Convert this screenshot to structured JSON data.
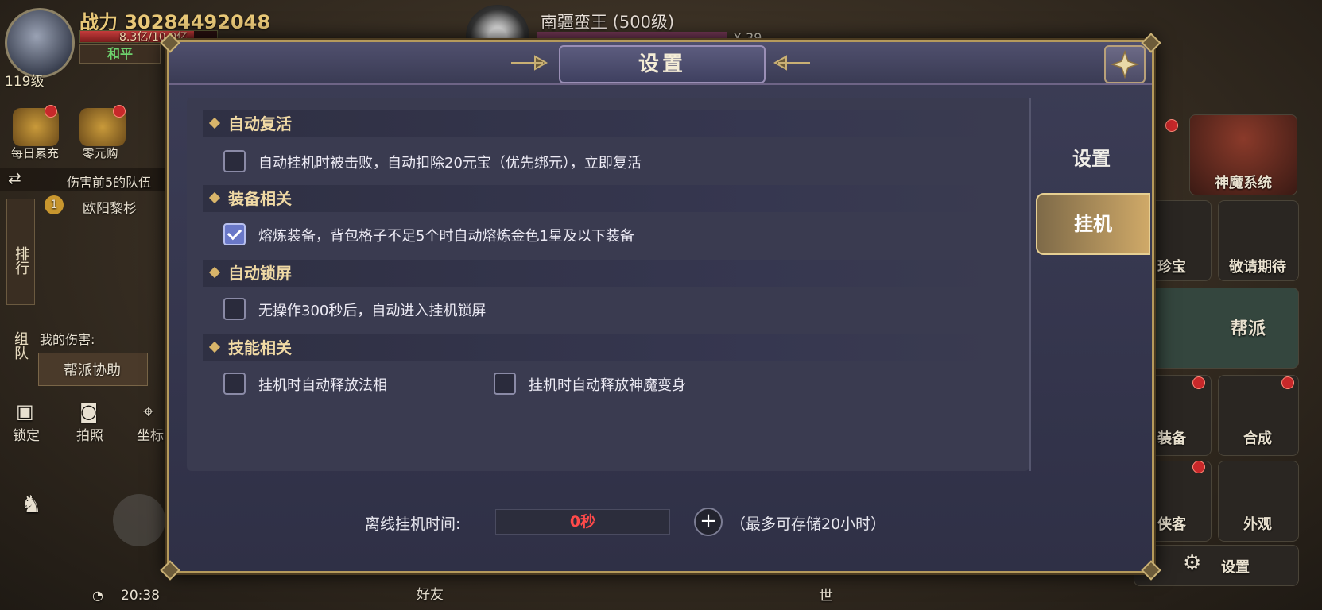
{
  "hud": {
    "power": "战力 30284492048",
    "hp_text": "8.3亿/10.0亿",
    "hp_ratio": 0.83,
    "mode": "和平",
    "level": "119级",
    "boss_name": "南疆蛮王 (500级)",
    "boss_count": "X 39",
    "daily_recharge": "每日累充",
    "zero_buy": "零元购",
    "team_hint": "伤害前5的队伍",
    "player_name": "欧阳黎杉",
    "tab_rank": "排行",
    "tab_team": "组队",
    "my_damage": "我的伤害:",
    "guild_help": "帮派协助",
    "lock": "锁定",
    "photo": "拍照",
    "coord": "坐标",
    "time": "20:38",
    "friends": "好友",
    "world": "世",
    "right_menu": {
      "shenmo": "神魔系统",
      "treasure": "珍宝",
      "coming": "敬请期待",
      "guild": "帮派",
      "equip": "装备",
      "compose": "合成",
      "xiake": "侠客",
      "appearance": "外观",
      "settings": "设置"
    }
  },
  "dialog": {
    "title": "设置",
    "tabs": [
      {
        "label": "设置",
        "active": false
      },
      {
        "label": "挂机",
        "active": true
      }
    ],
    "sections": [
      {
        "title": "自动复活",
        "options": [
          {
            "label": "自动挂机时被击败，自动扣除20元宝（优先绑元），立即复活",
            "checked": false
          }
        ]
      },
      {
        "title": "装备相关",
        "options": [
          {
            "label": "熔炼装备，背包格子不足5个时自动熔炼金色1星及以下装备",
            "checked": true
          }
        ]
      },
      {
        "title": "自动锁屏",
        "options": [
          {
            "label": "无操作300秒后，自动进入挂机锁屏",
            "checked": false
          }
        ]
      },
      {
        "title": "技能相关",
        "options": [
          {
            "label": "挂机时自动释放法相",
            "checked": false
          },
          {
            "label": "挂机时自动释放神魔变身",
            "checked": false
          }
        ]
      }
    ],
    "offline": {
      "label": "离线挂机时间:",
      "value": "0秒",
      "value_color": "#ff4a4a",
      "note": "（最多可存储20小时）"
    }
  },
  "colors": {
    "accent_gold": "#d9b56a",
    "checkbox_checked": "#6a78c8"
  }
}
